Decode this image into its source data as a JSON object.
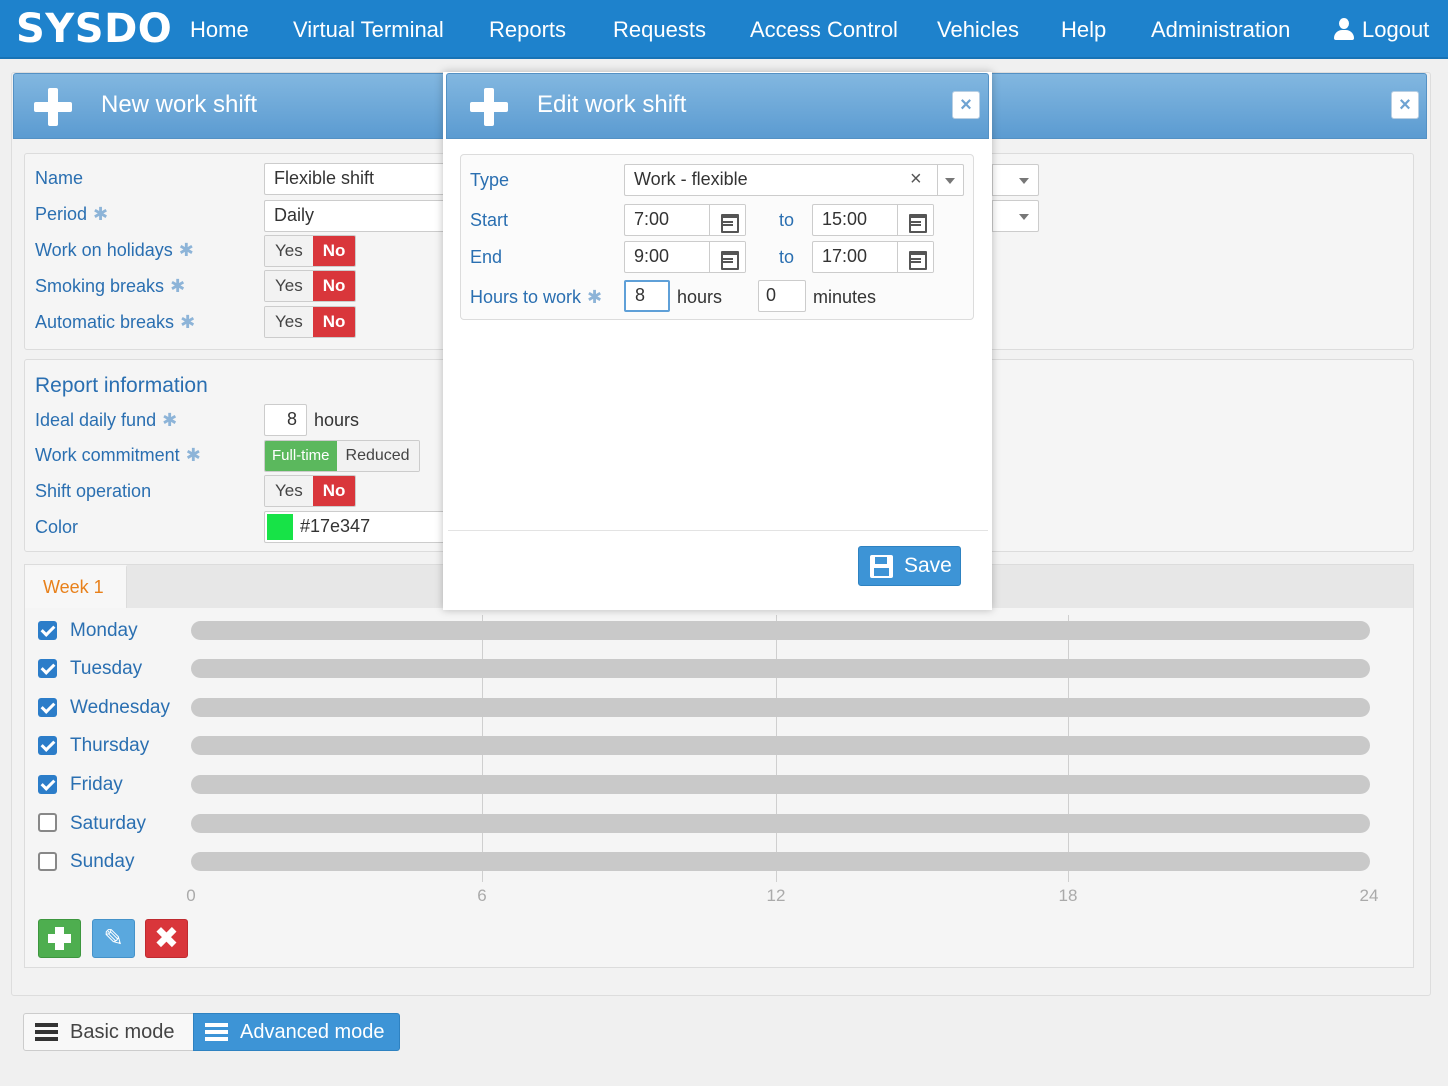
{
  "nav": {
    "brand": "SYSDO",
    "items": [
      "Home",
      "Virtual Terminal",
      "Reports",
      "Requests",
      "Access Control",
      "Vehicles",
      "Help",
      "Administration"
    ],
    "logout": "Logout"
  },
  "main_panel": {
    "title": "New work shift",
    "close": "×",
    "fields": {
      "name_label": "Name",
      "name_value": "Flexible shift",
      "period_label": "Period",
      "period_value": "Daily",
      "holidays_label": "Work on holidays",
      "smoking_label": "Smoking breaks",
      "auto_label": "Automatic breaks",
      "yes": "Yes",
      "no": "No",
      "required_mark": "✱"
    },
    "report": {
      "heading": "Report information",
      "fund_label": "Ideal daily fund",
      "fund_value": "8",
      "fund_unit": "hours",
      "commitment_label": "Work commitment",
      "fulltime": "Full-time",
      "reduced": "Reduced",
      "shift_label": "Shift operation",
      "color_label": "Color",
      "color_value": "#17e347"
    },
    "week_tab": "Week 1",
    "days": [
      {
        "name": "Monday",
        "checked": true
      },
      {
        "name": "Tuesday",
        "checked": true
      },
      {
        "name": "Wednesday",
        "checked": true
      },
      {
        "name": "Thursday",
        "checked": true
      },
      {
        "name": "Friday",
        "checked": true
      },
      {
        "name": "Saturday",
        "checked": false
      },
      {
        "name": "Sunday",
        "checked": false
      }
    ],
    "axis_ticks": [
      "0",
      "6",
      "12",
      "18",
      "24"
    ]
  },
  "modes": {
    "basic": "Basic mode",
    "advanced": "Advanced mode",
    "active": "advanced"
  },
  "modal": {
    "title": "Edit work shift",
    "close": "×",
    "type_label": "Type",
    "type_value": "Work - flexible",
    "type_clear": "×",
    "start_label": "Start",
    "start_from": "7:00",
    "start_to": "15:00",
    "end_label": "End",
    "end_from": "9:00",
    "end_to": "17:00",
    "to": "to",
    "hours_label": "Hours to work",
    "hours_value": "8",
    "hours_unit": "hours",
    "minutes_value": "0",
    "minutes_unit": "minutes",
    "save": "Save"
  },
  "colors": {
    "accent": "#1e82cc",
    "danger": "#d9363b",
    "success": "#5bb85d",
    "shift_color": "#17e347"
  },
  "icons": [
    "user-icon",
    "plus-icon",
    "close-icon",
    "calendar-icon",
    "dropdown-arrow-icon",
    "save-icon",
    "pencil-icon",
    "delete-icon",
    "list-icon",
    "checkbox-icon"
  ]
}
